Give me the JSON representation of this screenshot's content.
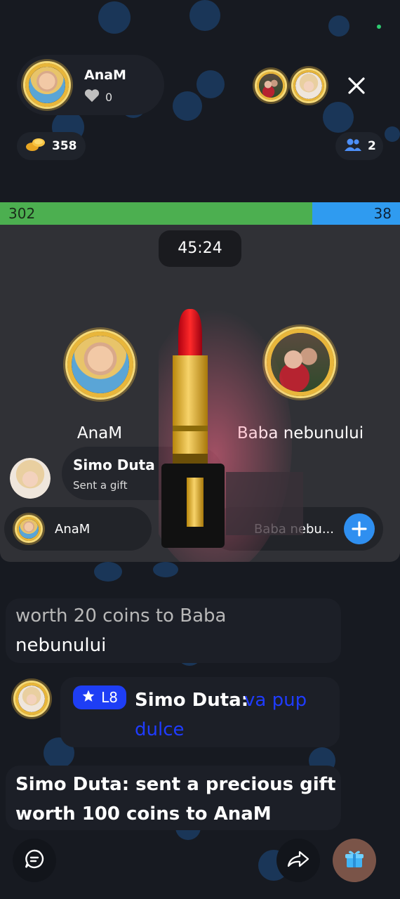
{
  "host": {
    "name": "AnaM",
    "likes": "0"
  },
  "coins": "358",
  "viewers": "2",
  "score": {
    "left": "302",
    "right": "38"
  },
  "timer": "45:24",
  "pk": {
    "left_name": "AnaM",
    "right_name": "Baba nebunului"
  },
  "gift_toast": {
    "sender": "Simo Duta",
    "action": "Sent a gift"
  },
  "teams": {
    "left": "AnaM",
    "right": "Baba nebu..."
  },
  "chat": {
    "msg1": "worth 20 coins to Baba",
    "msg1b": "nebunului",
    "badge_level": "L8",
    "msg2_user": "Simo Duta:",
    "msg2_text1": "va pup",
    "msg2_text2": "dulce",
    "msg3_line1": "Simo Duta: sent a precious gift",
    "msg3_line2": "worth 100 coins to AnaM"
  },
  "colors": {
    "background": "#171a21",
    "green": "#4caf50",
    "blue": "#2f9bf0",
    "gold": "#e8b63b",
    "chat_link": "#1f3cff"
  },
  "icons": [
    "heart-icon",
    "coins-icon",
    "users-icon",
    "close-icon",
    "plus-icon",
    "star-icon",
    "chat-icon",
    "share-icon",
    "gift-icon"
  ]
}
